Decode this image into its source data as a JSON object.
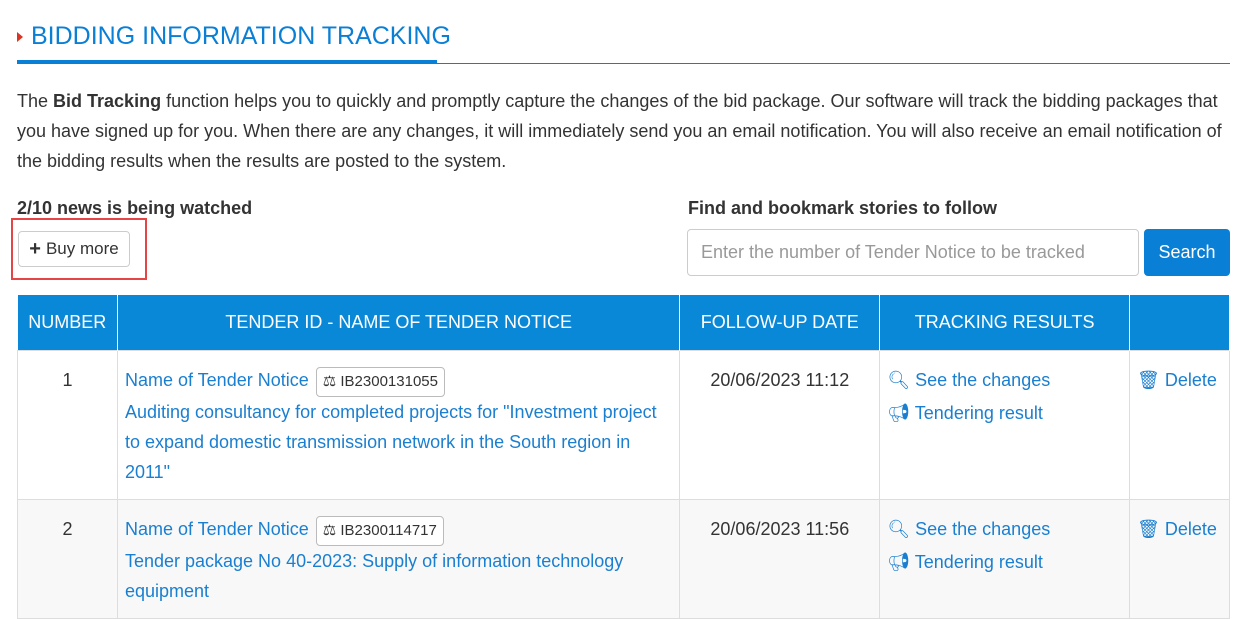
{
  "title": "BIDDING INFORMATION TRACKING",
  "description": {
    "pre": "The ",
    "bold": "Bid Tracking",
    "post": " function helps you to quickly and promptly capture the changes of the bid package. Our software will track the bidding packages that you have signed up for you. When there are any changes, it will immediately send you an email notification. You will also receive an email notification of the bidding results when the results are posted to the system."
  },
  "watched": "2/10 news is being watched",
  "buy_more": "Buy more",
  "find_label": "Find and bookmark stories to follow",
  "search": {
    "placeholder": "Enter the number of Tender Notice to be tracked",
    "button": "Search"
  },
  "table": {
    "headers": [
      "NUMBER",
      "TENDER ID - NAME OF TENDER NOTICE",
      "FOLLOW-UP DATE",
      "TRACKING RESULTS",
      ""
    ],
    "rows": [
      {
        "number": "1",
        "name_label": "Name of Tender Notice",
        "id": "IB2300131055",
        "title": "Auditing consultancy for completed projects for \"Investment project to expand domestic transmission network in the South region in 2011\"",
        "date": "20/06/2023 11:12",
        "see": "See the changes",
        "result": "Tendering result",
        "delete": "Delete"
      },
      {
        "number": "2",
        "name_label": "Name of Tender Notice",
        "id": "IB2300114717",
        "title": "Tender package No 40-2023: Supply of information technology equipment",
        "date": "20/06/2023 11:56",
        "see": "See the changes",
        "result": "Tendering result",
        "delete": "Delete"
      }
    ]
  },
  "colors": {
    "accent": "#0a7fd6",
    "highlight": "#e64545"
  }
}
